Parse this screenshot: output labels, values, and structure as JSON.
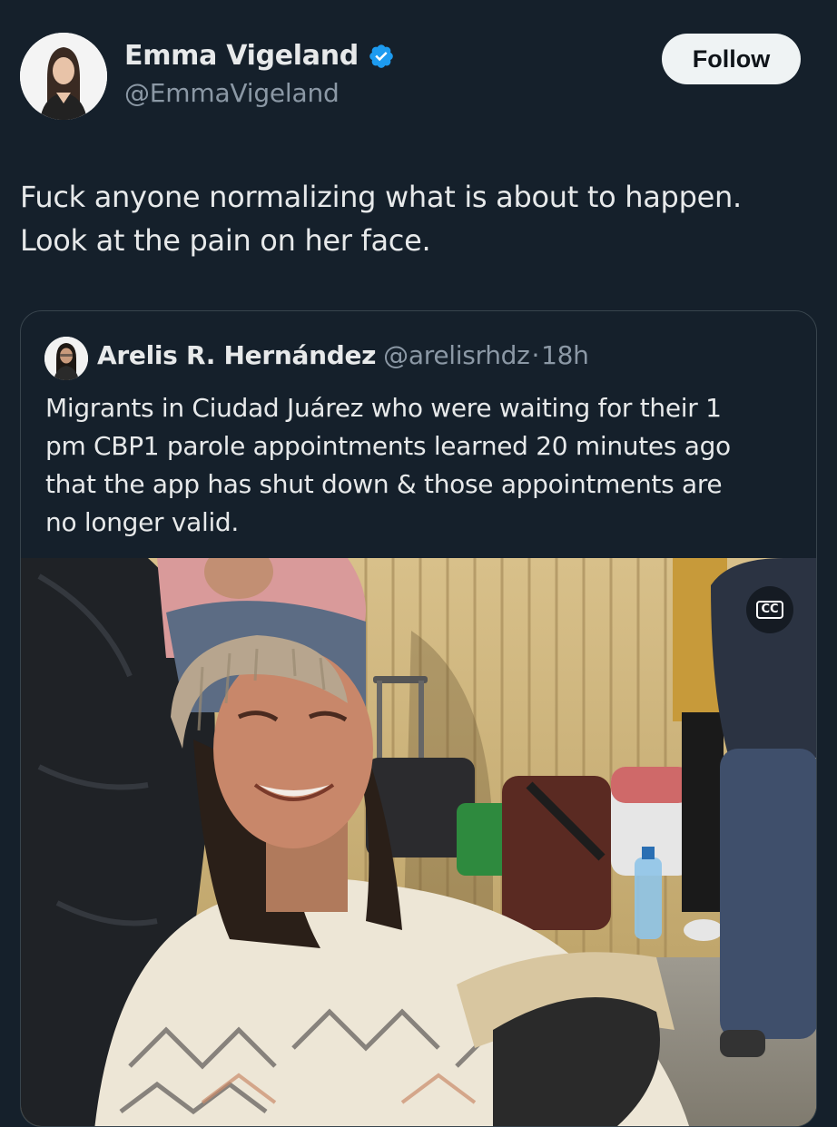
{
  "author": {
    "name": "Emma Vigeland",
    "handle": "@EmmaVigeland",
    "verified": true,
    "avatar_icon": "profile-photo"
  },
  "follow_label": "Follow",
  "tweet_lines": [
    "Fuck anyone normalizing what is about to happen.",
    "Look at the pain on her face."
  ],
  "quoted": {
    "name": "Arelis R. Hernández",
    "handle": "@arelisrhdz",
    "separator": "·",
    "time": "18h",
    "text_lines": [
      "Migrants in Ciudad Juárez who were waiting for their 1",
      "pm CBP1 parole appointments learned 20 minutes ago",
      "that the app has shut down & those appointments are",
      "no longer valid."
    ],
    "media": {
      "type": "video",
      "cc_label": "CC"
    }
  },
  "colors": {
    "background": "#15202b",
    "text": "#e7e9ea",
    "muted": "#8b98a5",
    "verified_badge": "#1d9bf0",
    "follow_bg": "#eff3f4",
    "card_border": "#38444d"
  }
}
